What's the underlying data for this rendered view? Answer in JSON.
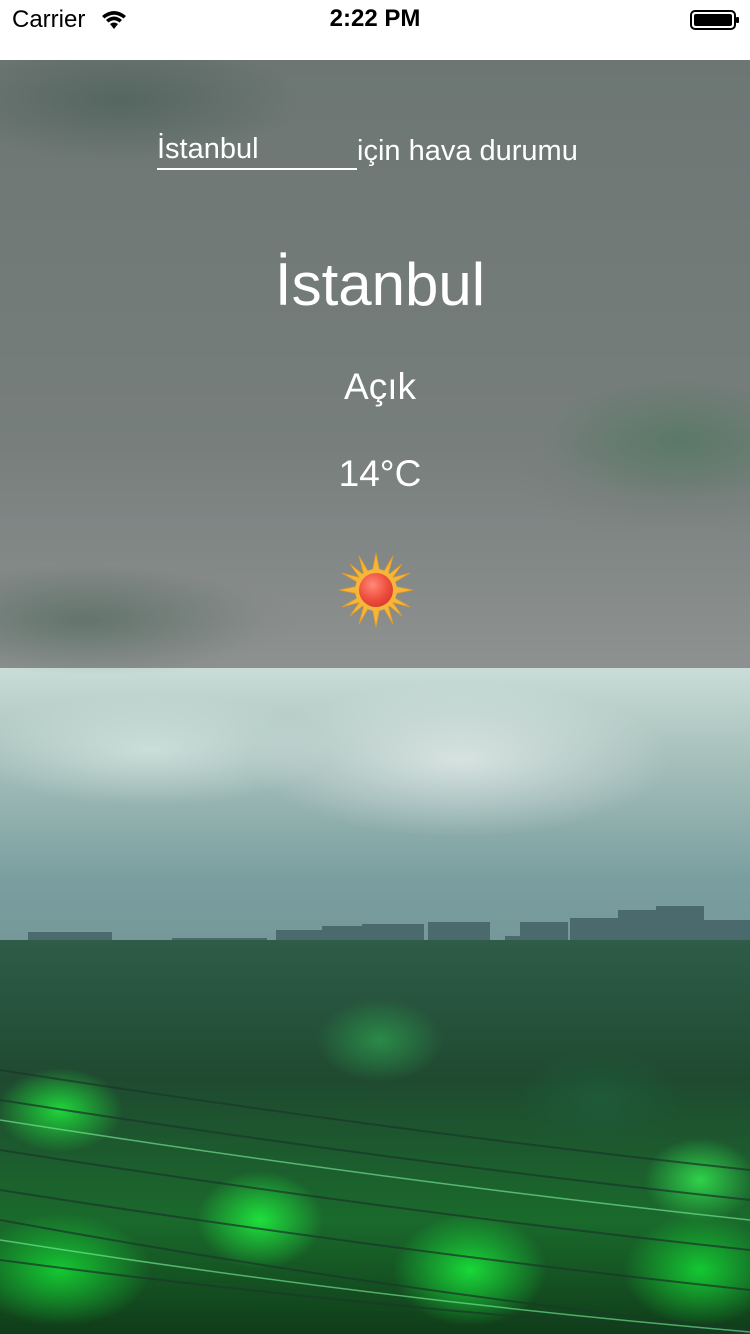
{
  "status_bar": {
    "carrier": "Carrier",
    "time": "2:22 PM"
  },
  "search": {
    "city_input_value": "İstanbul",
    "suffix": "için hava durumu"
  },
  "weather": {
    "city": "İstanbul",
    "condition": "Açık",
    "temperature": "14°C",
    "icon": "sun-icon"
  },
  "colors": {
    "overlay": "#7a7a7a",
    "text": "#ffffff",
    "sun_core": "#f05a4a",
    "sun_rays": "#f6b63a"
  }
}
